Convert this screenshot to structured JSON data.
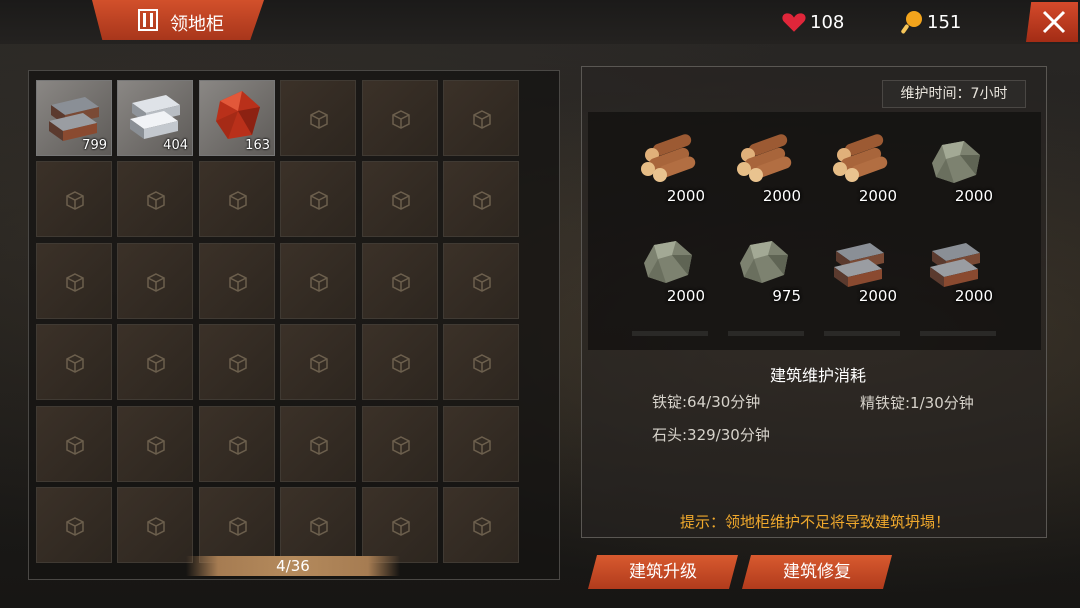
{
  "window": {
    "title": "领地柜"
  },
  "stats": {
    "health": "108",
    "food": "151"
  },
  "inventory": {
    "capacity": "4/36",
    "items": [
      {
        "kind": "iron-ingot",
        "count": "799"
      },
      {
        "kind": "refined-iron-ingot",
        "count": "404"
      },
      {
        "kind": "red-crystal",
        "count": "163"
      }
    ]
  },
  "maintenance": {
    "time_label": "维护时间：7小时",
    "resources": [
      {
        "kind": "wood",
        "count": "2000"
      },
      {
        "kind": "wood",
        "count": "2000"
      },
      {
        "kind": "wood",
        "count": "2000"
      },
      {
        "kind": "stone",
        "count": "2000"
      },
      {
        "kind": "stone",
        "count": "2000"
      },
      {
        "kind": "stone",
        "count": "975"
      },
      {
        "kind": "iron-ingot",
        "count": "2000"
      },
      {
        "kind": "iron-ingot",
        "count": "2000"
      }
    ],
    "section_title": "建筑维护消耗",
    "costs": {
      "iron": "铁锭:64/30分钟",
      "refined_iron": "精铁锭:1/30分钟",
      "stone": "石头:329/30分钟"
    },
    "hint": "提示：领地柜维护不足将导致建筑坍塌！"
  },
  "buttons": {
    "upgrade": "建筑升级",
    "repair": "建筑修复"
  },
  "colors": {
    "accent": "#c8461f",
    "hint": "#f0a92c"
  }
}
